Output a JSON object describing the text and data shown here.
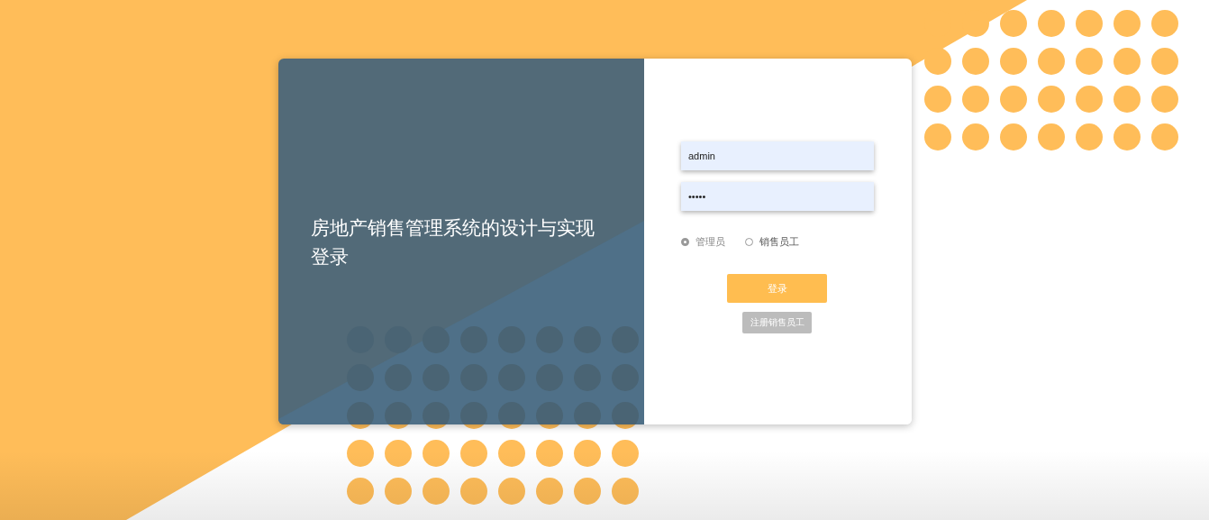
{
  "title": "房地产销售管理系统的设计与实现登录",
  "username": {
    "value": "admin"
  },
  "password": {
    "value": "•••••"
  },
  "roles": [
    {
      "label": "管理员",
      "selected": true
    },
    {
      "label": "销售员工",
      "selected": false
    }
  ],
  "login_button": "登录",
  "register_button": "注册销售员工"
}
